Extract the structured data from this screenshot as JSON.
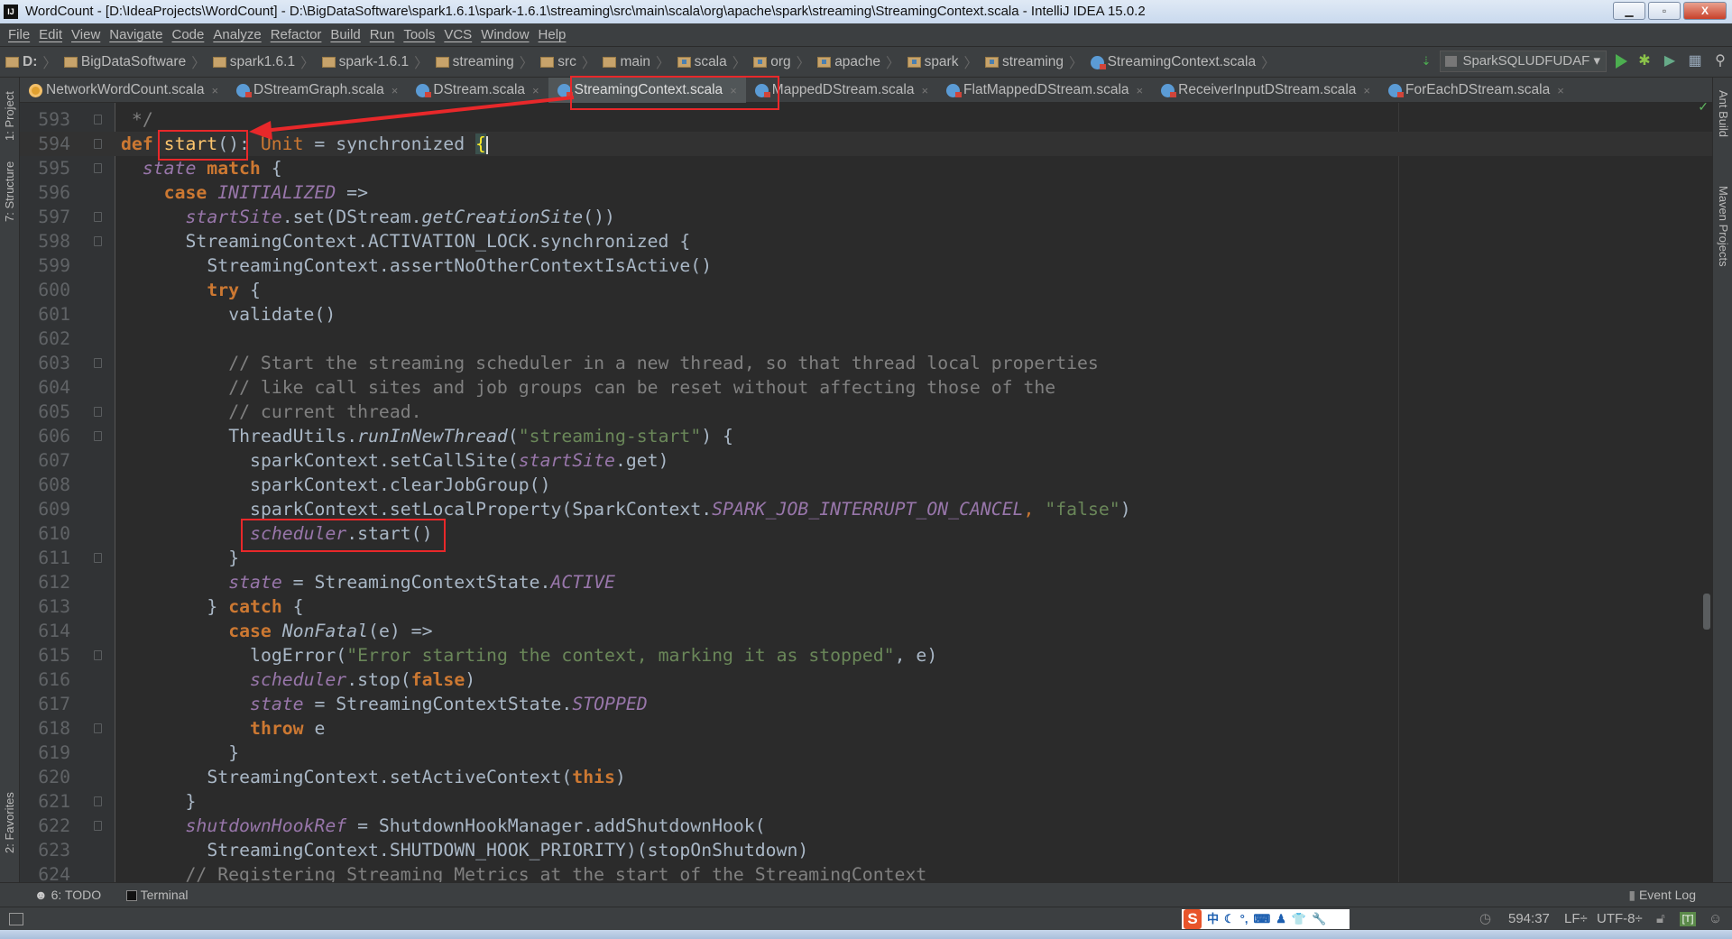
{
  "window": {
    "title": "WordCount - [D:\\IdeaProjects\\WordCount] - D:\\BigDataSoftware\\spark1.6.1\\spark-1.6.1\\streaming\\src\\main\\scala\\org\\apache\\spark\\streaming\\StreamingContext.scala - IntelliJ IDEA 15.0.2",
    "app_icon": "IJ"
  },
  "menu": [
    "File",
    "Edit",
    "View",
    "Navigate",
    "Code",
    "Analyze",
    "Refactor",
    "Build",
    "Run",
    "Tools",
    "VCS",
    "Window",
    "Help"
  ],
  "breadcrumbs": [
    {
      "label": "D:",
      "icon": "folder"
    },
    {
      "label": "BigDataSoftware",
      "icon": "folder"
    },
    {
      "label": "spark1.6.1",
      "icon": "folder"
    },
    {
      "label": "spark-1.6.1",
      "icon": "folder"
    },
    {
      "label": "streaming",
      "icon": "folder"
    },
    {
      "label": "src",
      "icon": "folder"
    },
    {
      "label": "main",
      "icon": "folder"
    },
    {
      "label": "scala",
      "icon": "package"
    },
    {
      "label": "org",
      "icon": "package"
    },
    {
      "label": "apache",
      "icon": "package"
    },
    {
      "label": "spark",
      "icon": "package"
    },
    {
      "label": "streaming",
      "icon": "package"
    },
    {
      "label": "StreamingContext.scala",
      "icon": "scala-file"
    }
  ],
  "run_config": "SparkSQLUDFUDAF",
  "tabs": [
    {
      "label": "NetworkWordCount.scala",
      "icon": "object",
      "active": false
    },
    {
      "label": "DStreamGraph.scala",
      "icon": "scala-class",
      "active": false
    },
    {
      "label": "DStream.scala",
      "icon": "scala-class",
      "active": false
    },
    {
      "label": "StreamingContext.scala",
      "icon": "scala-class",
      "active": true
    },
    {
      "label": "MappedDStream.scala",
      "icon": "scala-class",
      "active": false
    },
    {
      "label": "FlatMappedDStream.scala",
      "icon": "scala-class",
      "active": false
    },
    {
      "label": "ReceiverInputDStream.scala",
      "icon": "scala-class",
      "active": false
    },
    {
      "label": "ForEachDStream.scala",
      "icon": "scala-class",
      "active": false
    }
  ],
  "left_tools": [
    "1: Project",
    "7: Structure",
    "2: Favorites"
  ],
  "right_tools": [
    "Ant Build",
    "Maven Projects"
  ],
  "code": [
    {
      "n": "593",
      "i": 0,
      "t": [
        [
          "com",
          " */"
        ]
      ]
    },
    {
      "n": "594",
      "i": 0,
      "caret": true,
      "t": [
        [
          "kw",
          "def"
        ],
        [
          "p",
          " "
        ],
        [
          "decl",
          "start"
        ],
        [
          "p",
          "(): "
        ],
        [
          "type",
          "Unit"
        ],
        [
          "p",
          " = synchronized "
        ],
        [
          "brace",
          "{"
        ]
      ]
    },
    {
      "n": "595",
      "i": 1,
      "t": [
        [
          "field",
          "state"
        ],
        [
          "p",
          " "
        ],
        [
          "kw",
          "match"
        ],
        [
          "p",
          " {"
        ]
      ]
    },
    {
      "n": "596",
      "i": 2,
      "t": [
        [
          "kw",
          "case"
        ],
        [
          "p",
          " "
        ],
        [
          "const",
          "INITIALIZED"
        ],
        [
          "p",
          " =>"
        ]
      ]
    },
    {
      "n": "597",
      "i": 3,
      "t": [
        [
          "field",
          "startSite"
        ],
        [
          "p",
          ".set(DStream."
        ],
        [
          "it",
          "getCreationSite"
        ],
        [
          "p",
          "())"
        ]
      ]
    },
    {
      "n": "598",
      "i": 3,
      "t": [
        [
          "p",
          "StreamingContext.ACTIVATION_LOCK.synchronized {"
        ]
      ]
    },
    {
      "n": "599",
      "i": 4,
      "t": [
        [
          "p",
          "StreamingContext.assertNoOtherContextIsActive()"
        ]
      ]
    },
    {
      "n": "600",
      "i": 4,
      "t": [
        [
          "kw",
          "try"
        ],
        [
          "p",
          " {"
        ]
      ]
    },
    {
      "n": "601",
      "i": 5,
      "t": [
        [
          "p",
          "validate()"
        ]
      ]
    },
    {
      "n": "602",
      "i": 5,
      "t": []
    },
    {
      "n": "603",
      "i": 5,
      "t": [
        [
          "com",
          "// Start the streaming scheduler in a new thread, so that thread local properties"
        ]
      ]
    },
    {
      "n": "604",
      "i": 5,
      "t": [
        [
          "com",
          "// like call sites and job groups can be reset without affecting those of the"
        ]
      ]
    },
    {
      "n": "605",
      "i": 5,
      "t": [
        [
          "com",
          "// current thread."
        ]
      ]
    },
    {
      "n": "606",
      "i": 5,
      "t": [
        [
          "p",
          "ThreadUtils."
        ],
        [
          "it",
          "runInNewThread"
        ],
        [
          "p",
          "("
        ],
        [
          "str",
          "\"streaming-start\""
        ],
        [
          "p",
          ") {"
        ]
      ]
    },
    {
      "n": "607",
      "i": 6,
      "t": [
        [
          "p",
          "sparkContext.setCallSite("
        ],
        [
          "field",
          "startSite"
        ],
        [
          "p",
          ".get)"
        ]
      ]
    },
    {
      "n": "608",
      "i": 6,
      "t": [
        [
          "p",
          "sparkContext.clearJobGroup()"
        ]
      ]
    },
    {
      "n": "609",
      "i": 6,
      "t": [
        [
          "p",
          "sparkContext.setLocalProperty(SparkContext."
        ],
        [
          "const",
          "SPARK_JOB_INTERRUPT_ON_CANCEL"
        ],
        [
          "type",
          ", "
        ],
        [
          "str",
          "\"false\""
        ],
        [
          "p",
          ")"
        ]
      ]
    },
    {
      "n": "610",
      "i": 6,
      "t": [
        [
          "field",
          "scheduler"
        ],
        [
          "p",
          ".start()"
        ]
      ]
    },
    {
      "n": "611",
      "i": 5,
      "t": [
        [
          "p",
          "}"
        ]
      ]
    },
    {
      "n": "612",
      "i": 5,
      "t": [
        [
          "field",
          "state"
        ],
        [
          "p",
          " = StreamingContextState."
        ],
        [
          "const",
          "ACTIVE"
        ]
      ]
    },
    {
      "n": "613",
      "i": 4,
      "t": [
        [
          "p",
          "} "
        ],
        [
          "kw",
          "catch"
        ],
        [
          "p",
          " {"
        ]
      ]
    },
    {
      "n": "614",
      "i": 5,
      "t": [
        [
          "kw",
          "case"
        ],
        [
          "p",
          " "
        ],
        [
          "it",
          "NonFatal"
        ],
        [
          "p",
          "(e) =>"
        ]
      ]
    },
    {
      "n": "615",
      "i": 6,
      "t": [
        [
          "p",
          "logError("
        ],
        [
          "str",
          "\"Error starting the context, marking it as stopped\""
        ],
        [
          "p",
          ", e)"
        ]
      ]
    },
    {
      "n": "616",
      "i": 6,
      "t": [
        [
          "field",
          "scheduler"
        ],
        [
          "p",
          ".stop("
        ],
        [
          "kw",
          "false"
        ],
        [
          "p",
          ")"
        ]
      ]
    },
    {
      "n": "617",
      "i": 6,
      "t": [
        [
          "field",
          "state"
        ],
        [
          "p",
          " = StreamingContextState."
        ],
        [
          "const",
          "STOPPED"
        ]
      ]
    },
    {
      "n": "618",
      "i": 6,
      "t": [
        [
          "kw",
          "throw"
        ],
        [
          "p",
          " e"
        ]
      ]
    },
    {
      "n": "619",
      "i": 5,
      "t": [
        [
          "p",
          "}"
        ]
      ]
    },
    {
      "n": "620",
      "i": 4,
      "t": [
        [
          "p",
          "StreamingContext.setActiveContext("
        ],
        [
          "kw",
          "this"
        ],
        [
          "p",
          ")"
        ]
      ]
    },
    {
      "n": "621",
      "i": 3,
      "t": [
        [
          "p",
          "}"
        ]
      ]
    },
    {
      "n": "622",
      "i": 3,
      "t": [
        [
          "field",
          "shutdownHookRef"
        ],
        [
          "p",
          " = ShutdownHookManager.addShutdownHook("
        ]
      ]
    },
    {
      "n": "623",
      "i": 4,
      "t": [
        [
          "p",
          "StreamingContext.SHUTDOWN_HOOK_PRIORITY)(stopOnShutdown)"
        ]
      ]
    },
    {
      "n": "624",
      "i": 3,
      "t": [
        [
          "com",
          "// Registering Streaming Metrics at the start of the StreamingContext"
        ]
      ]
    }
  ],
  "bottom_tools": {
    "todo": "6: TODO",
    "terminal": "Terminal",
    "event_log": "Event Log"
  },
  "status": {
    "position": "594:37",
    "line_sep": "LF÷",
    "encoding": "UTF-8÷"
  },
  "ime": {
    "logo": "S",
    "mode": "中"
  },
  "colors": {
    "annotation": "#e8282a",
    "editor_bg": "#2b2b2b",
    "keyword": "#cc7832",
    "field": "#9876aa",
    "string": "#6a8759",
    "comment": "#808080"
  }
}
